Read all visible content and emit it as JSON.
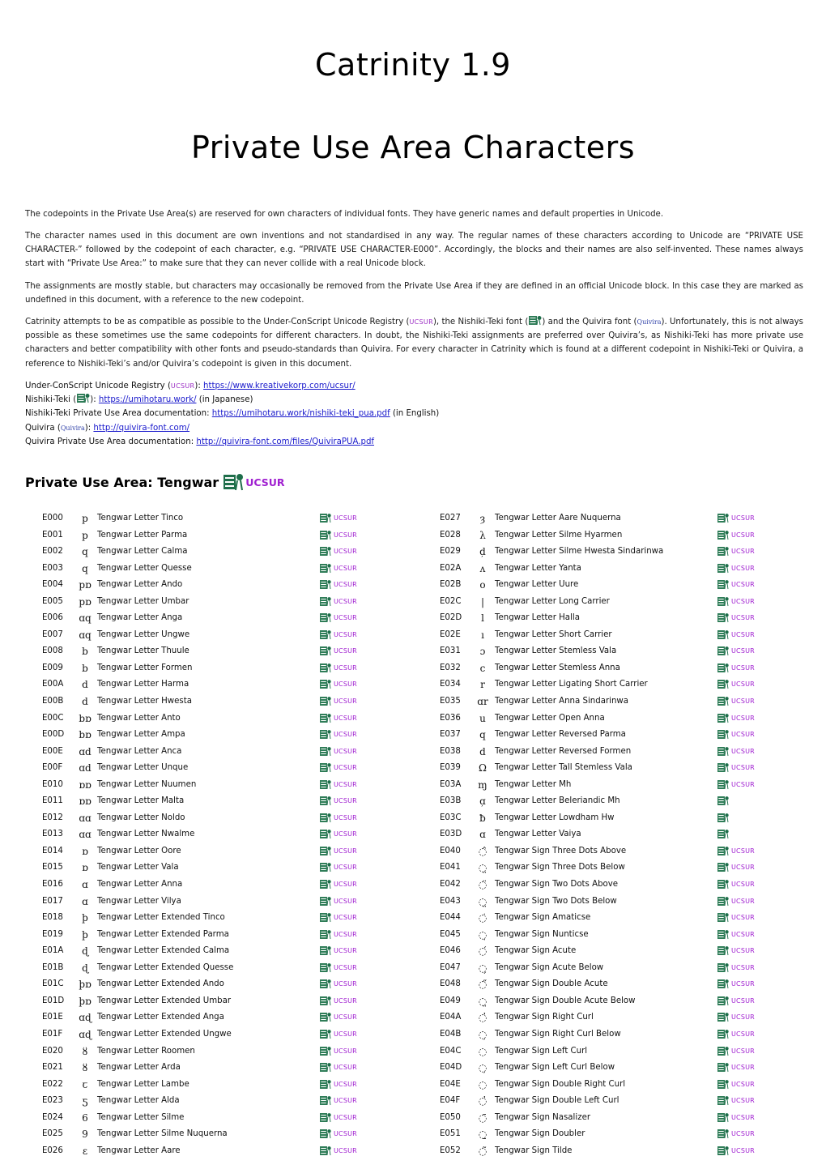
{
  "title_line1": "Catrinity 1.9",
  "title_line2": "Private Use Area Characters",
  "paragraphs": {
    "p1": "The codepoints in the Private Use Area(s) are reserved for own characters of individual fonts. They have generic names and default properties in Unicode.",
    "p2": "The character names used in this document are own inventions and not standardised in any way. The regular names of these characters according to Unicode are “PRIVATE USE CHARACTER-” followed by the codepoint of each character, e.g. “PRIVATE USE CHARACTER-E000”. Accordingly, the blocks and their names are also self-invented. These names always start with “Private Use Area:” to make sure that they can never collide with a real Unicode block.",
    "p3": "The assignments are mostly stable, but characters may occasionally be removed from the Private Use Area if they are defined in an official Unicode block. In this case they are marked as undefined in this document, with a reference to the new codepoint.",
    "p4_a": "Catrinity attempts to be as compatible as possible to the Under-ConScript Unicode Registry (",
    "p4_ucsur": "UCSUR",
    "p4_b": "), the Nishiki-Teki font (",
    "p4_c": ") and the Quivira font (",
    "p4_quivira": "Quivira",
    "p4_d": "). Unfortunately, this is not always possible as these sometimes use the same codepoints for different characters. In doubt, the Nishiki-Teki assignments are preferred over Quivira’s, as Nishiki-Teki has more private use characters and better compatibility with other fonts and pseudo-standards than Quivira. For every character in Catrinity which is found at a different codepoint in Nishiki-Teki or Quivira, a reference to Nishiki-Teki’s and/or Quivira’s codepoint is given in this document."
  },
  "links": [
    {
      "prefix": "Under-ConScript Unicode Registry (",
      "badge": "UCSUR",
      "badge_type": "ucsur",
      "mid": "): ",
      "url": "https://www.kreativekorp.com/ucsur/",
      "suffix": ""
    },
    {
      "prefix": "Nishiki-Teki (",
      "badge": "",
      "badge_type": "nishiki",
      "mid": "): ",
      "url": "https://umihotaru.work/",
      "suffix": " (in Japanese)"
    },
    {
      "prefix": "Nishiki-Teki Private Use Area documentation: ",
      "badge": "",
      "badge_type": "none",
      "mid": "",
      "url": "https://umihotaru.work/nishiki-teki_pua.pdf",
      "suffix": " (in English)"
    },
    {
      "prefix": "Quivira (",
      "badge": "Quivira",
      "badge_type": "quivira",
      "mid": "): ",
      "url": "http://quivira-font.com/",
      "suffix": ""
    },
    {
      "prefix": "Quivira Private Use Area documentation: ",
      "badge": "",
      "badge_type": "none",
      "mid": "",
      "url": "http://quivira-font.com/files/QuiviraPUA.pdf",
      "suffix": ""
    }
  ],
  "section": {
    "heading": "Private Use Area: Tengwar",
    "badge_ucsur": "UCSUR"
  },
  "colors": {
    "ucsur": "#a020d0",
    "nishiki": "#1e6e4a",
    "link": "#1a1acc"
  },
  "ucsur_label": "UCSUR",
  "left_rows": [
    {
      "cp": "E000",
      "glyph": "p",
      "name": "Tengwar Letter Tinco",
      "nishiki": true,
      "ucsur": true
    },
    {
      "cp": "E001",
      "glyph": "p",
      "name": "Tengwar Letter Parma",
      "nishiki": true,
      "ucsur": true
    },
    {
      "cp": "E002",
      "glyph": "q",
      "name": "Tengwar Letter Calma",
      "nishiki": true,
      "ucsur": true
    },
    {
      "cp": "E003",
      "glyph": "q",
      "name": "Tengwar Letter Quesse",
      "nishiki": true,
      "ucsur": true
    },
    {
      "cp": "E004",
      "glyph": "pɒ",
      "name": "Tengwar Letter Ando",
      "nishiki": true,
      "ucsur": true
    },
    {
      "cp": "E005",
      "glyph": "pɒ",
      "name": "Tengwar Letter Umbar",
      "nishiki": true,
      "ucsur": true
    },
    {
      "cp": "E006",
      "glyph": "ɑq",
      "name": "Tengwar Letter Anga",
      "nishiki": true,
      "ucsur": true
    },
    {
      "cp": "E007",
      "glyph": "ɑq",
      "name": "Tengwar Letter Ungwe",
      "nishiki": true,
      "ucsur": true
    },
    {
      "cp": "E008",
      "glyph": "b",
      "name": "Tengwar Letter Thuule",
      "nishiki": true,
      "ucsur": true
    },
    {
      "cp": "E009",
      "glyph": "b",
      "name": "Tengwar Letter Formen",
      "nishiki": true,
      "ucsur": true
    },
    {
      "cp": "E00A",
      "glyph": "d",
      "name": "Tengwar Letter Harma",
      "nishiki": true,
      "ucsur": true
    },
    {
      "cp": "E00B",
      "glyph": "d",
      "name": "Tengwar Letter Hwesta",
      "nishiki": true,
      "ucsur": true
    },
    {
      "cp": "E00C",
      "glyph": "bɒ",
      "name": "Tengwar Letter Anto",
      "nishiki": true,
      "ucsur": true
    },
    {
      "cp": "E00D",
      "glyph": "bɒ",
      "name": "Tengwar Letter Ampa",
      "nishiki": true,
      "ucsur": true
    },
    {
      "cp": "E00E",
      "glyph": "ɑd",
      "name": "Tengwar Letter Anca",
      "nishiki": true,
      "ucsur": true
    },
    {
      "cp": "E00F",
      "glyph": "ɑd",
      "name": "Tengwar Letter Unque",
      "nishiki": true,
      "ucsur": true
    },
    {
      "cp": "E010",
      "glyph": "ɒɒ",
      "name": "Tengwar Letter Nuumen",
      "nishiki": true,
      "ucsur": true
    },
    {
      "cp": "E011",
      "glyph": "ɒɒ",
      "name": "Tengwar Letter Malta",
      "nishiki": true,
      "ucsur": true
    },
    {
      "cp": "E012",
      "glyph": "ɑɑ",
      "name": "Tengwar Letter Noldo",
      "nishiki": true,
      "ucsur": true
    },
    {
      "cp": "E013",
      "glyph": "ɑɑ",
      "name": "Tengwar Letter Nwalme",
      "nishiki": true,
      "ucsur": true
    },
    {
      "cp": "E014",
      "glyph": "ɒ",
      "name": "Tengwar Letter Oore",
      "nishiki": true,
      "ucsur": true
    },
    {
      "cp": "E015",
      "glyph": "ɒ",
      "name": "Tengwar Letter Vala",
      "nishiki": true,
      "ucsur": true
    },
    {
      "cp": "E016",
      "glyph": "ɑ",
      "name": "Tengwar Letter Anna",
      "nishiki": true,
      "ucsur": true
    },
    {
      "cp": "E017",
      "glyph": "ɑ",
      "name": "Tengwar Letter Vilya",
      "nishiki": true,
      "ucsur": true
    },
    {
      "cp": "E018",
      "glyph": "þ",
      "name": "Tengwar Letter Extended Tinco",
      "nishiki": true,
      "ucsur": true
    },
    {
      "cp": "E019",
      "glyph": "þ",
      "name": "Tengwar Letter Extended Parma",
      "nishiki": true,
      "ucsur": true
    },
    {
      "cp": "E01A",
      "glyph": "ɖ",
      "name": "Tengwar Letter Extended Calma",
      "nishiki": true,
      "ucsur": true
    },
    {
      "cp": "E01B",
      "glyph": "ɖ",
      "name": "Tengwar Letter Extended Quesse",
      "nishiki": true,
      "ucsur": true
    },
    {
      "cp": "E01C",
      "glyph": "þɒ",
      "name": "Tengwar Letter Extended Ando",
      "nishiki": true,
      "ucsur": true
    },
    {
      "cp": "E01D",
      "glyph": "þɒ",
      "name": "Tengwar Letter Extended Umbar",
      "nishiki": true,
      "ucsur": true
    },
    {
      "cp": "E01E",
      "glyph": "ɑɖ",
      "name": "Tengwar Letter Extended Anga",
      "nishiki": true,
      "ucsur": true
    },
    {
      "cp": "E01F",
      "glyph": "ɑɖ",
      "name": "Tengwar Letter Extended Ungwe",
      "nishiki": true,
      "ucsur": true
    },
    {
      "cp": "E020",
      "glyph": "ȣ",
      "name": "Tengwar Letter Roomen",
      "nishiki": true,
      "ucsur": true
    },
    {
      "cp": "E021",
      "glyph": "ȣ",
      "name": "Tengwar Letter Arda",
      "nishiki": true,
      "ucsur": true
    },
    {
      "cp": "E022",
      "glyph": "ꞇ",
      "name": "Tengwar Letter Lambe",
      "nishiki": true,
      "ucsur": true
    },
    {
      "cp": "E023",
      "glyph": "ƽ",
      "name": "Tengwar Letter Alda",
      "nishiki": true,
      "ucsur": true
    },
    {
      "cp": "E024",
      "glyph": "6",
      "name": "Tengwar Letter Silme",
      "nishiki": true,
      "ucsur": true
    },
    {
      "cp": "E025",
      "glyph": "9",
      "name": "Tengwar Letter Silme Nuquerna",
      "nishiki": true,
      "ucsur": true
    },
    {
      "cp": "E026",
      "glyph": "ɛ",
      "name": "Tengwar Letter Aare",
      "nishiki": true,
      "ucsur": true
    }
  ],
  "right_rows": [
    {
      "cp": "E027",
      "glyph": "ȝ",
      "name": "Tengwar Letter Aare Nuquerna",
      "nishiki": true,
      "ucsur": true
    },
    {
      "cp": "E028",
      "glyph": "λ",
      "name": "Tengwar Letter Silme Hyarmen",
      "nishiki": true,
      "ucsur": true
    },
    {
      "cp": "E029",
      "glyph": "d̦",
      "name": "Tengwar Letter Silme Hwesta Sindarinwa",
      "nishiki": true,
      "ucsur": true
    },
    {
      "cp": "E02A",
      "glyph": "ʌ",
      "name": "Tengwar Letter Yanta",
      "nishiki": true,
      "ucsur": true
    },
    {
      "cp": "E02B",
      "glyph": "o",
      "name": "Tengwar Letter Uure",
      "nishiki": true,
      "ucsur": true
    },
    {
      "cp": "E02C",
      "glyph": "|",
      "name": "Tengwar Letter Long Carrier",
      "nishiki": true,
      "ucsur": true
    },
    {
      "cp": "E02D",
      "glyph": "l",
      "name": "Tengwar Letter Halla",
      "nishiki": true,
      "ucsur": true
    },
    {
      "cp": "E02E",
      "glyph": "ı",
      "name": "Tengwar Letter Short Carrier",
      "nishiki": true,
      "ucsur": true
    },
    {
      "cp": "E031",
      "glyph": "ɔ",
      "name": "Tengwar Letter Stemless Vala",
      "nishiki": true,
      "ucsur": true
    },
    {
      "cp": "E032",
      "glyph": "c",
      "name": "Tengwar Letter Stemless Anna",
      "nishiki": true,
      "ucsur": true
    },
    {
      "cp": "E034",
      "glyph": "r",
      "name": "Tengwar Letter Ligating Short Carrier",
      "nishiki": true,
      "ucsur": true
    },
    {
      "cp": "E035",
      "glyph": "ɑr",
      "name": "Tengwar Letter Anna Sindarinwa",
      "nishiki": true,
      "ucsur": true
    },
    {
      "cp": "E036",
      "glyph": "u",
      "name": "Tengwar Letter Open Anna",
      "nishiki": true,
      "ucsur": true
    },
    {
      "cp": "E037",
      "glyph": "q",
      "name": "Tengwar Letter Reversed Parma",
      "nishiki": true,
      "ucsur": true
    },
    {
      "cp": "E038",
      "glyph": "d",
      "name": "Tengwar Letter Reversed Formen",
      "nishiki": true,
      "ucsur": true
    },
    {
      "cp": "E039",
      "glyph": "Ω",
      "name": "Tengwar Letter Tall Stemless Vala",
      "nishiki": true,
      "ucsur": true
    },
    {
      "cp": "E03A",
      "glyph": "ɱ",
      "name": "Tengwar Letter Mh",
      "nishiki": true,
      "ucsur": true
    },
    {
      "cp": "E03B",
      "glyph": "ɑ̦",
      "name": "Tengwar Letter Beleriandic Mh",
      "nishiki": true,
      "ucsur": false
    },
    {
      "cp": "E03C",
      "glyph": "ƀ",
      "name": "Tengwar Letter Lowdham Hw",
      "nishiki": true,
      "ucsur": false
    },
    {
      "cp": "E03D",
      "glyph": "ɑ",
      "name": "Tengwar Letter Vaiya",
      "nishiki": true,
      "ucsur": false
    },
    {
      "cp": "E040",
      "glyph": "◌̂",
      "name": "Tengwar Sign Three Dots Above",
      "nishiki": true,
      "ucsur": true
    },
    {
      "cp": "E041",
      "glyph": "◌̤",
      "name": "Tengwar Sign Three Dots Below",
      "nishiki": true,
      "ucsur": true
    },
    {
      "cp": "E042",
      "glyph": "◌̈",
      "name": "Tengwar Sign Two Dots Above",
      "nishiki": true,
      "ucsur": true
    },
    {
      "cp": "E043",
      "glyph": "◌̤",
      "name": "Tengwar Sign Two Dots Below",
      "nishiki": true,
      "ucsur": true
    },
    {
      "cp": "E044",
      "glyph": "◌̇",
      "name": "Tengwar Sign Amaticse",
      "nishiki": true,
      "ucsur": true
    },
    {
      "cp": "E045",
      "glyph": "◌̣",
      "name": "Tengwar Sign Nunticse",
      "nishiki": true,
      "ucsur": true
    },
    {
      "cp": "E046",
      "glyph": "◌́",
      "name": "Tengwar Sign Acute",
      "nishiki": true,
      "ucsur": true
    },
    {
      "cp": "E047",
      "glyph": "◌̗",
      "name": "Tengwar Sign Acute Below",
      "nishiki": true,
      "ucsur": true
    },
    {
      "cp": "E048",
      "glyph": "◌̋",
      "name": "Tengwar Sign Double Acute",
      "nishiki": true,
      "ucsur": true
    },
    {
      "cp": "E049",
      "glyph": "◌̤",
      "name": "Tengwar Sign Double Acute Below",
      "nishiki": true,
      "ucsur": true
    },
    {
      "cp": "E04A",
      "glyph": "◌̓",
      "name": "Tengwar Sign Right Curl",
      "nishiki": true,
      "ucsur": true
    },
    {
      "cp": "E04B",
      "glyph": "◌̦",
      "name": "Tengwar Sign Right Curl Below",
      "nishiki": true,
      "ucsur": true
    },
    {
      "cp": "E04C",
      "glyph": "◌",
      "name": "Tengwar Sign Left Curl",
      "nishiki": true,
      "ucsur": true
    },
    {
      "cp": "E04D",
      "glyph": "◌̦",
      "name": "Tengwar Sign Left Curl Below",
      "nishiki": true,
      "ucsur": true
    },
    {
      "cp": "E04E",
      "glyph": "◌",
      "name": "Tengwar Sign Double Right Curl",
      "nishiki": true,
      "ucsur": true
    },
    {
      "cp": "E04F",
      "glyph": "◌̓",
      "name": "Tengwar Sign Double Left Curl",
      "nishiki": true,
      "ucsur": true
    },
    {
      "cp": "E050",
      "glyph": "◌̄",
      "name": "Tengwar Sign Nasalizer",
      "nishiki": true,
      "ucsur": true
    },
    {
      "cp": "E051",
      "glyph": "◌̱",
      "name": "Tengwar Sign Doubler",
      "nishiki": true,
      "ucsur": true
    },
    {
      "cp": "E052",
      "glyph": "◌̃",
      "name": "Tengwar Sign Tilde",
      "nishiki": true,
      "ucsur": true
    }
  ]
}
